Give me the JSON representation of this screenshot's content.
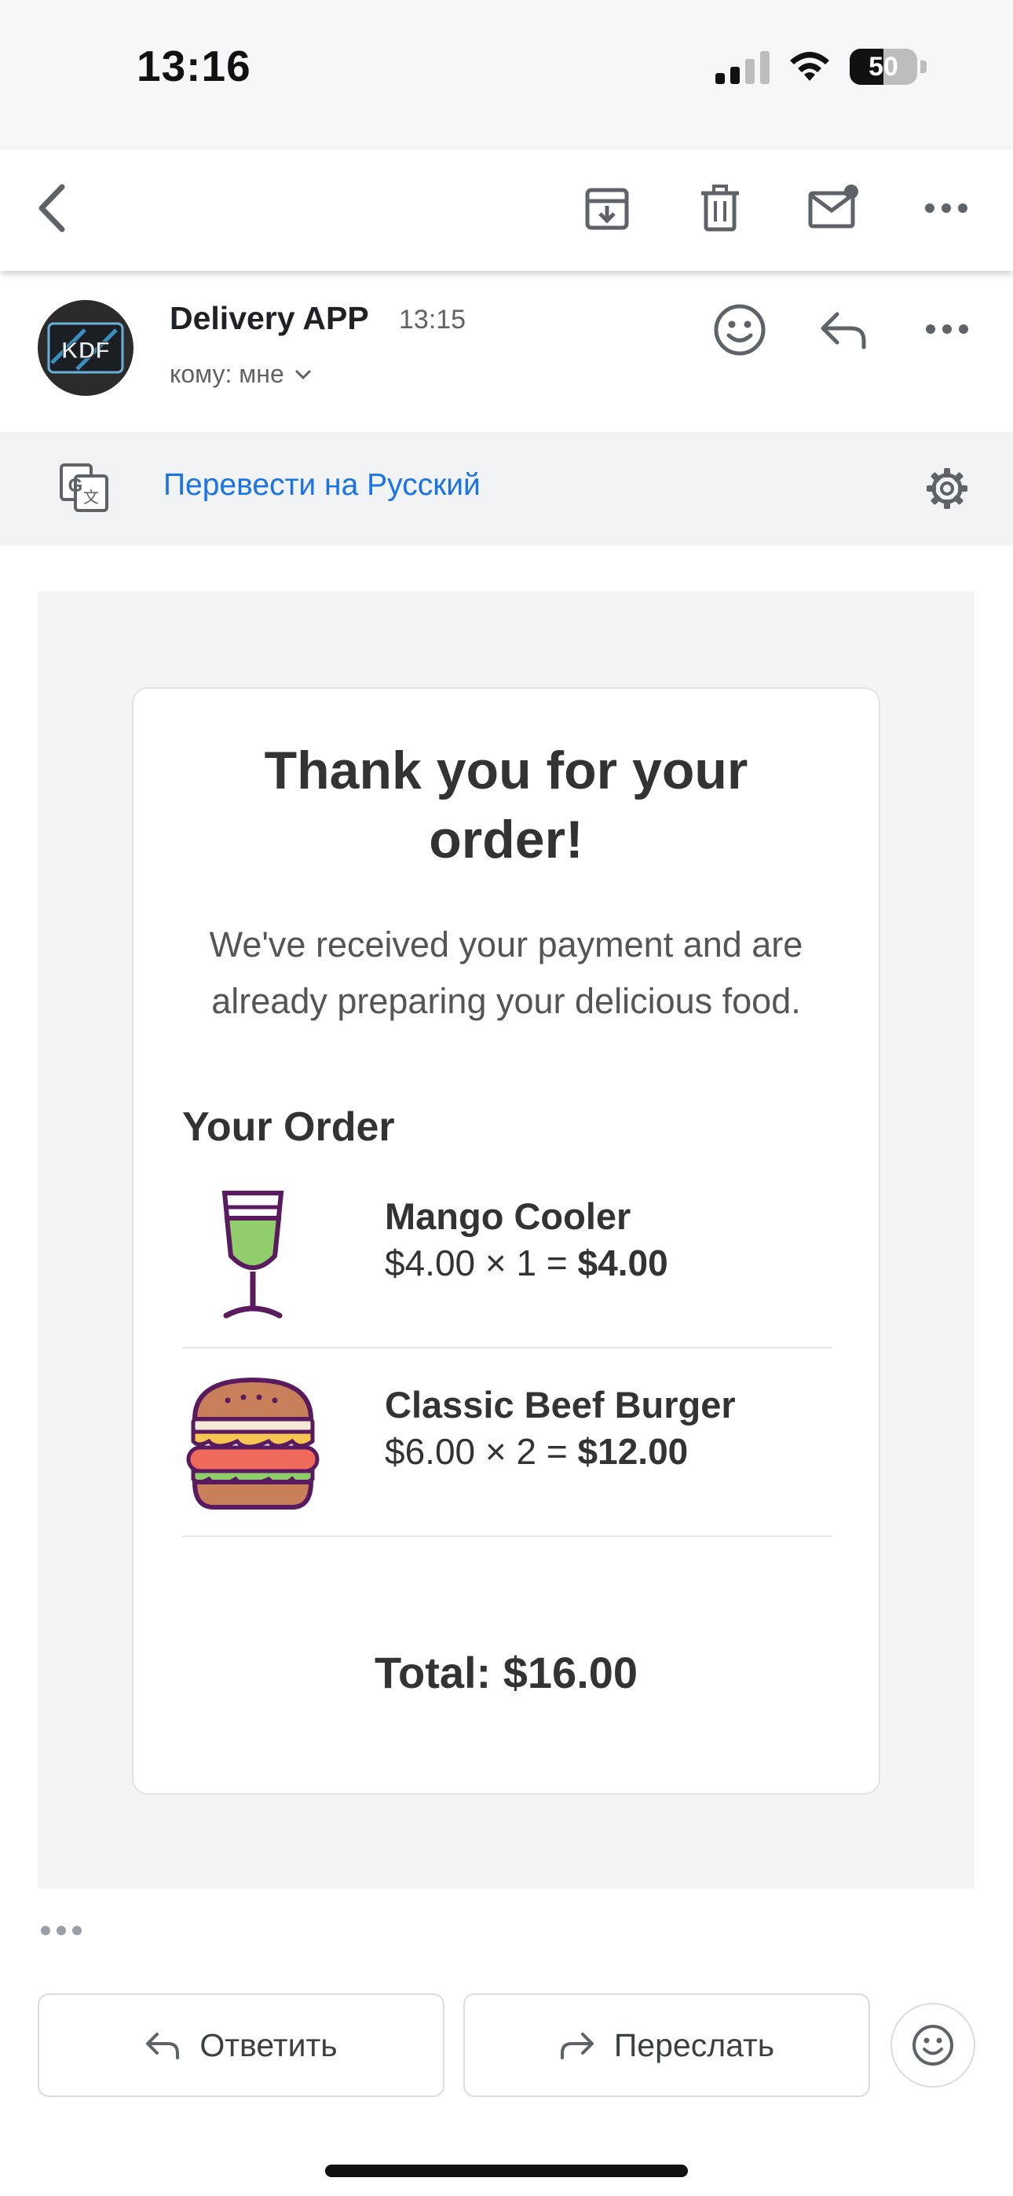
{
  "status_bar": {
    "time": "13:16",
    "battery": "50",
    "icons": [
      "signal-icon",
      "wifi-icon",
      "battery-icon"
    ]
  },
  "toolbar": {
    "icons": [
      "back-icon",
      "archive-icon",
      "trash-icon",
      "mark-unread-icon",
      "more-icon"
    ]
  },
  "message": {
    "sender": "Delivery APP",
    "time": "13:15",
    "recipient": "кому: мне",
    "avatar_text": "KDF"
  },
  "translate": {
    "label": "Перевести на Русский"
  },
  "email": {
    "title": "Thank you for your order!",
    "subtitle": "We've received your payment and are already preparing your delicious food.",
    "order_heading": "Your Order",
    "items": [
      {
        "name": "Mango Cooler",
        "price_expr": "$4.00 × 1 = ",
        "line_total": "$4.00",
        "icon": "drink-glass-icon"
      },
      {
        "name": "Classic Beef Burger",
        "price_expr": "$6.00 × 2 = ",
        "line_total": "$12.00",
        "icon": "burger-icon"
      }
    ],
    "total": "Total: $16.00"
  },
  "actions": {
    "reply": "Ответить",
    "forward": "Переслать"
  },
  "colors": {
    "link_blue": "#1a73e8",
    "translate_bg": "#f1f3f4",
    "email_bg": "#f4f4f4",
    "drink_green": "#8fce6a",
    "purple_outline": "#5a1a5e"
  }
}
